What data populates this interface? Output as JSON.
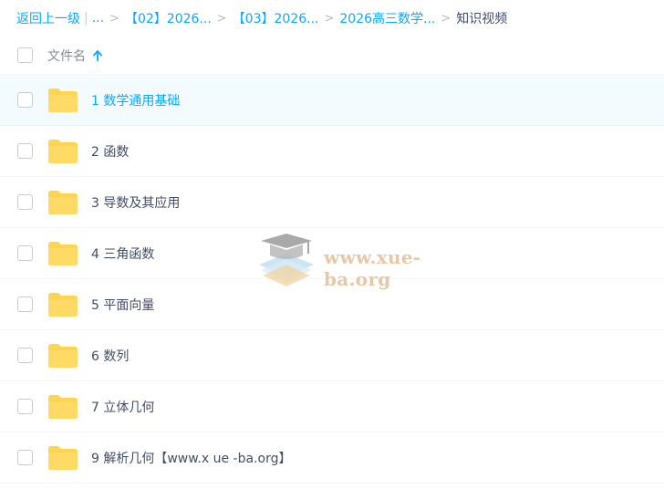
{
  "breadcrumb": {
    "back_label": "返回上一级",
    "divider": "|",
    "ellipsis": "...",
    "separator": ">",
    "items": [
      "【02】2026...",
      "【03】2026...",
      "2026高三数学..."
    ],
    "current": "知识视频"
  },
  "header": {
    "column_title": "文件名",
    "sort_icon": "arrow-up-icon"
  },
  "rows": [
    {
      "name": "1 数学通用基础",
      "icon": "folder-icon"
    },
    {
      "name": "2 函数",
      "icon": "folder-icon"
    },
    {
      "name": "3 导数及其应用",
      "icon": "folder-icon"
    },
    {
      "name": "4 三角函数",
      "icon": "folder-icon"
    },
    {
      "name": "5 平面向量",
      "icon": "folder-icon"
    },
    {
      "name": "6 数列",
      "icon": "folder-icon"
    },
    {
      "name": "7 立体几何",
      "icon": "folder-icon"
    },
    {
      "name": "9 解析几何【www.x ue -ba.org】",
      "icon": "folder-icon"
    }
  ],
  "watermark": {
    "text": "www.xue-ba.org"
  },
  "colors": {
    "accent": "#09aaff",
    "text": "#424e67",
    "folder": "#ffd44e",
    "hover_row": "#f4fbff"
  }
}
